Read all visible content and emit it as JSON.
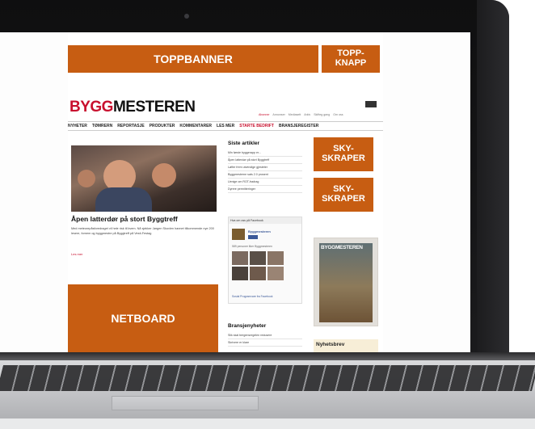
{
  "ad_slots": {
    "toppbanner": "TOPPBANNER",
    "toppknapp": "TOPP-\nKNAPP",
    "skyskraper_1": "SKY-\nSKRAPER",
    "skyskraper_2": "SKY-\nSKRAPER",
    "netboard": "NETBOARD"
  },
  "site": {
    "logo_accent": "BYGG",
    "logo_rest": "MESTEREN",
    "accent_color": "#c8102e",
    "ad_color": "#c75d12"
  },
  "top_nav": [
    "Abonner",
    "Annonser",
    "Mediasett",
    "Arkiv",
    "Skifteg gang",
    "Om oss"
  ],
  "main_nav": [
    {
      "label": "NYHETER"
    },
    {
      "label": "TØMRERN"
    },
    {
      "label": "REPORTASJE"
    },
    {
      "label": "PRODUKTER"
    },
    {
      "label": "KOMMENTARER"
    },
    {
      "label": "LES MER"
    },
    {
      "label": "STARTE BEDRIFT"
    },
    {
      "label": "BRANSJEREGISTER"
    }
  ],
  "featured": {
    "headline": "Åpen latterdør på stort Byggtreff",
    "lead": "Med meteorepåsforedraget vil hele risk til kvem. Nå sjekker Jørgen Skovlen hannet tilkommende nye 200 lesere, fornem og byggmestre på Byggtreff på Vesti-Festag",
    "read_more": "Les mer"
  },
  "latest": {
    "title": "Siste artikler",
    "items": [
      "Min første byggerapp er...",
      "Åpen latterdør på stort Byggtreff",
      "Løfter frem utvendige gjesteter",
      "Byggmesterne sats 2.0 prosent",
      "Uenige om ROT-fradrag",
      "Dyrere permitteringer"
    ]
  },
  "facebook": {
    "header": "Hva om oss på Facebook",
    "page_name": "Byggmesteren",
    "like_label": "Like",
    "fans_text": "589 personer liker Byggmesteren",
    "footer": "Sosial Programvare fra Facebook"
  },
  "bransje": {
    "title": "Bransjenyheter",
    "items": [
      "Slik skal bergensregelen redusere",
      "Skrivere er klare"
    ]
  },
  "magazine": {
    "cover_title": "BYGGMESTEREN"
  },
  "newsletter": {
    "title": "Nyhetsbrev"
  }
}
